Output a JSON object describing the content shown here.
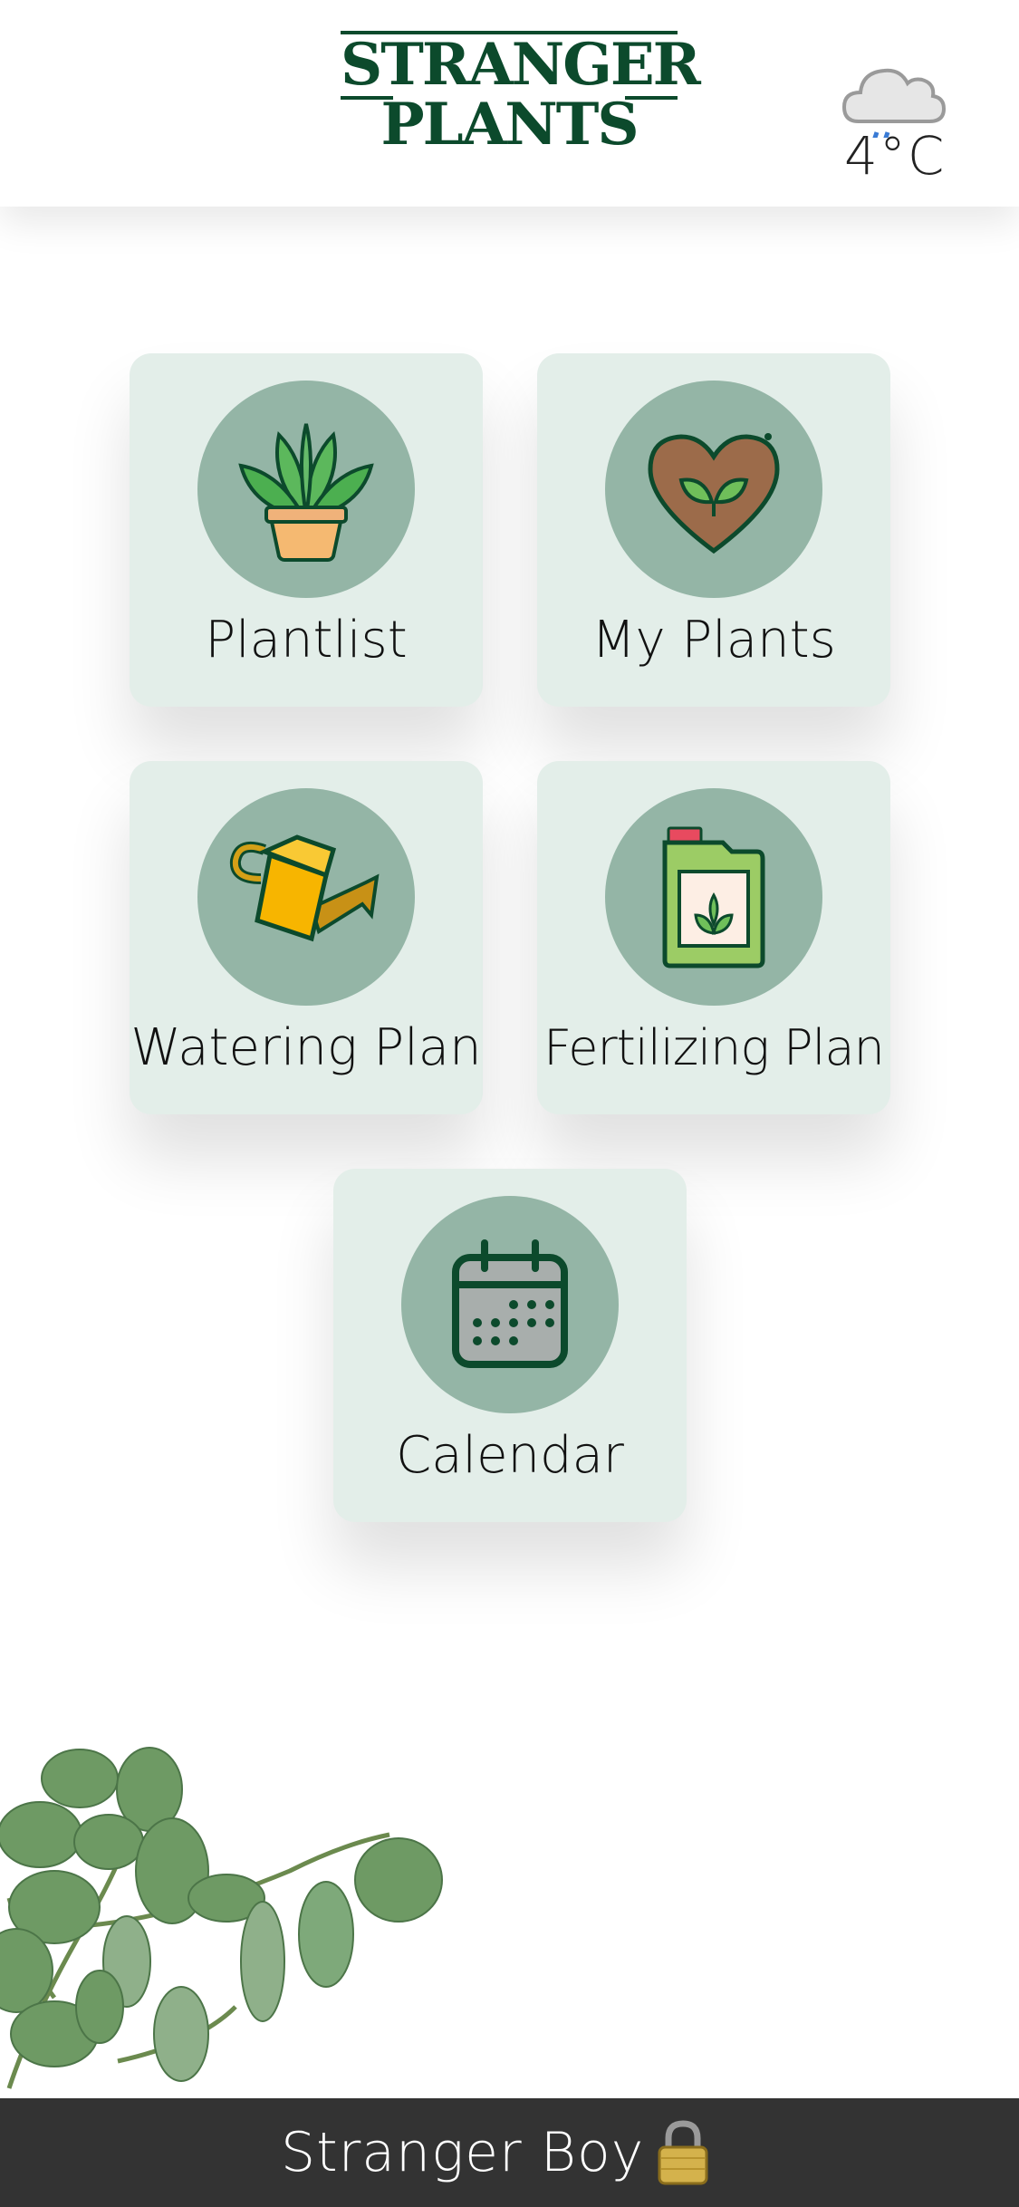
{
  "header": {
    "logo_line1": "STRANGER",
    "logo_line2": "PLANTS",
    "weather": {
      "icon": "cloud-rain-icon",
      "temperature": "4°C"
    }
  },
  "menu": {
    "plantlist": {
      "label": "Plantlist",
      "icon": "potted-plant-icon"
    },
    "my_plants": {
      "label": "My Plants",
      "icon": "heart-leaf-icon"
    },
    "watering_plan": {
      "label": "Watering Plan",
      "icon": "watering-can-icon"
    },
    "fertilizing_plan": {
      "label": "Fertilizing Plan",
      "icon": "fertilizer-canister-icon"
    },
    "calendar": {
      "label": "Calendar",
      "icon": "calendar-icon"
    }
  },
  "footer": {
    "username": "Stranger Boy",
    "lock_icon": "padlock-icon"
  },
  "colors": {
    "brand_green": "#0c4a2c",
    "tile_bg": "#e3eee9",
    "circle_bg": "#94b5a6",
    "footer_bg": "#333333"
  }
}
